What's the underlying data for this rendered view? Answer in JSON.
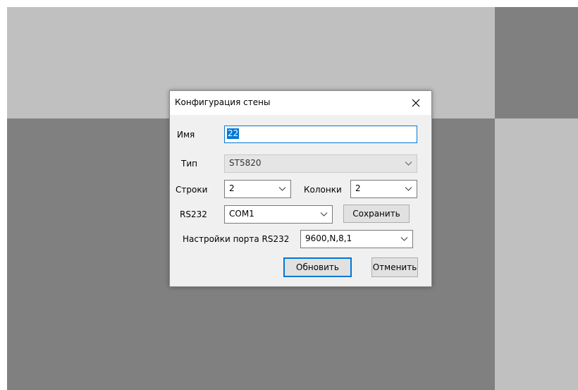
{
  "dialog": {
    "title": "Конфигурация стены",
    "fields": {
      "name": {
        "label": "Имя",
        "value": "22"
      },
      "type": {
        "label": "Тип",
        "value": "ST5820"
      },
      "rows": {
        "label": "Строки",
        "value": "2"
      },
      "columns": {
        "label": "Колонки",
        "value": "2"
      },
      "rs232": {
        "label": "RS232",
        "value": "COM1"
      },
      "port_settings": {
        "label": "Настройки порта RS232",
        "value": "9600,N,8,1"
      }
    },
    "buttons": {
      "save": "Сохранить",
      "update": "Обновить",
      "cancel": "Отменить"
    }
  },
  "icons": {
    "close": "close-icon",
    "dropdown": "chevron-down-icon"
  },
  "colors": {
    "accent": "#0078d7",
    "light_tile": "#c0c0c0",
    "dark_tile": "#808080",
    "dialog_bg": "#f0f0f0"
  }
}
